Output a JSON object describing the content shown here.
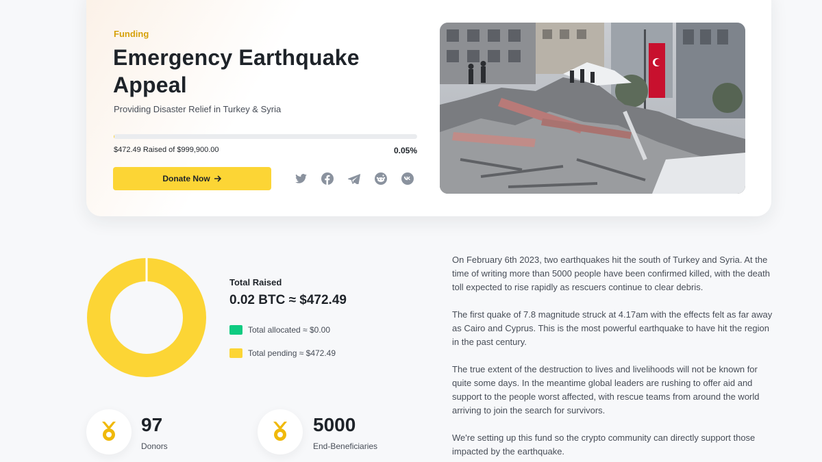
{
  "hero": {
    "eyebrow": "Funding",
    "title": "Emergency Earthquake Appeal",
    "subtitle": "Providing Disaster Relief in Turkey & Syria",
    "raised_text": "$472.49 Raised of $999,900.00",
    "percent_text": "0.05%",
    "progress_fraction": 0.0005,
    "donate_label": "Donate Now",
    "share_icons": [
      "twitter-icon",
      "facebook-icon",
      "telegram-icon",
      "reddit-icon",
      "vk-icon"
    ]
  },
  "summary": {
    "total_label": "Total Raised",
    "total_value": "0.02 BTC ≈ $472.49",
    "allocated_label": "Total allocated ≈ $0.00",
    "pending_label": "Total pending ≈ $472.49",
    "allocated_fraction": 0.0,
    "pending_fraction": 1.0
  },
  "stats": {
    "donors_value": "97",
    "donors_label": "Donors",
    "beneficiaries_value": "5000",
    "beneficiaries_label": "End-Beneficiaries"
  },
  "article": {
    "p1": "On February 6th 2023, two earthquakes hit the south of Turkey and Syria. At the time of writing more than 5000 people have been confirmed killed, with the death toll expected to rise rapidly as rescuers continue to clear debris.",
    "p2": "The first quake of 7.8 magnitude struck at 4.17am with the effects felt as far away as Cairo and Cyprus. This is the most powerful earthquake to have hit the region in the past century.",
    "p3": "The true extent of the destruction to lives and livelihoods will not be known for quite some days. In the meantime global leaders are rushing to offer aid and support to the people worst affected, with rescue teams from around the world arriving to join the search for survivors.",
    "p4": "We're setting up this fund so the crypto community can directly support those impacted by the earthquake."
  },
  "colors": {
    "brand_yellow": "#fcd535",
    "allocated_green": "#0ecb81",
    "accent_text": "#d6a10a"
  }
}
